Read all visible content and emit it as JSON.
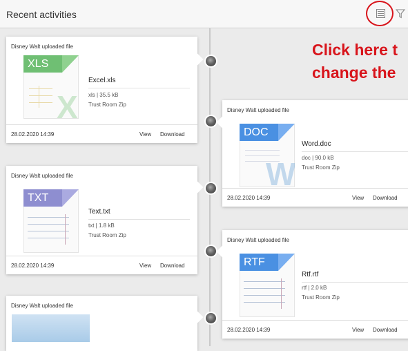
{
  "panel": {
    "title": "Recent activities",
    "view_toggle_icon": "list-view-icon",
    "filter_icon": "filter-icon"
  },
  "annotation": {
    "line1": "Click here t",
    "line2": "change the",
    "color": "#d8141b"
  },
  "cards": [
    {
      "header": "Disney Walt uploaded file",
      "file_name": "Excel.xls",
      "meta": "xls | 35.5 kB",
      "room": "Trust Room Zip",
      "date": "28.02.2020 14:39",
      "view": "View",
      "download": "Download",
      "badge": "XLS",
      "badge_color": "#6fbf73",
      "letter": "X",
      "letter_color": "#7bc47f"
    },
    {
      "header": "Disney Walt uploaded file",
      "file_name": "Word.doc",
      "meta": "doc | 90.0 kB",
      "room": "Trust Room Zip",
      "date": "28.02.2020 14:39",
      "view": "View",
      "download": "Download",
      "badge": "DOC",
      "badge_color": "#4a90e2",
      "letter": "W",
      "letter_color": "#5b9bd5"
    },
    {
      "header": "Disney Walt uploaded file",
      "file_name": "Text.txt",
      "meta": "txt | 1.8 kB",
      "room": "Trust Room Zip",
      "date": "28.02.2020 14:39",
      "view": "View",
      "download": "Download",
      "badge": "TXT",
      "badge_color": "#8e8ed0",
      "letter": "",
      "letter_color": ""
    },
    {
      "header": "Disney Walt uploaded file",
      "file_name": "Rtf.rtf",
      "meta": "rtf | 2.0 kB",
      "room": "Trust Room Zip",
      "date": "28.02.2020 14:39",
      "view": "View",
      "download": "Download",
      "badge": "RTF",
      "badge_color": "#4a90e2",
      "letter": "",
      "letter_color": ""
    },
    {
      "header": "Disney Walt uploaded file"
    }
  ]
}
